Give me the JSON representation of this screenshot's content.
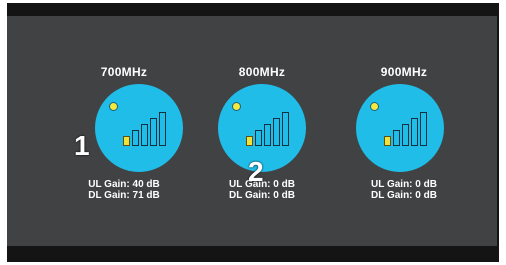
{
  "bands": [
    {
      "title": "700MHz",
      "ul_gain": "UL Gain: 40 dB",
      "dl_gain": "DL Gain: 71 dB",
      "signal_bars_lit": 1,
      "signal_bars_total": 5
    },
    {
      "title": "800MHz",
      "ul_gain": "UL Gain: 0  dB",
      "dl_gain": "DL Gain: 0  dB",
      "signal_bars_lit": 1,
      "signal_bars_total": 5
    },
    {
      "title": "900MHz",
      "ul_gain": "UL Gain: 0  dB",
      "dl_gain": "DL Gain: 0  dB",
      "signal_bars_lit": 1,
      "signal_bars_total": 5
    }
  ],
  "markers": [
    "1",
    "2"
  ],
  "colors": {
    "screen_bg": "#404243",
    "frame": "#141414",
    "dial": "#21bde9",
    "indicator": "#f1e23a",
    "text": "#ffffff"
  },
  "icons": {
    "status": "status-dot-icon",
    "signal": "signal-strength-icon"
  }
}
